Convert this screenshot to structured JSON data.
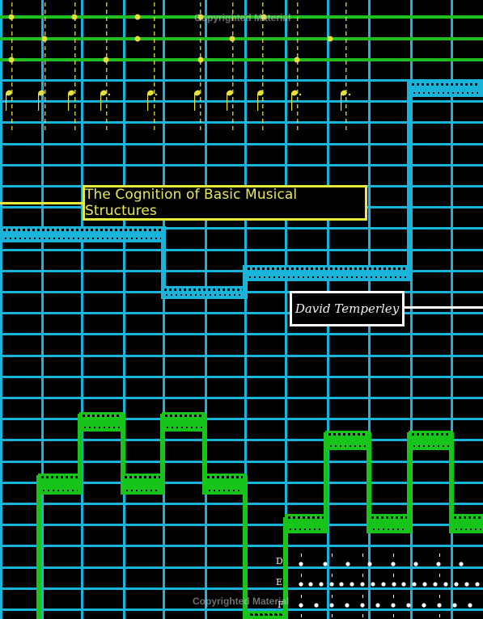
{
  "book": {
    "title": "The Cognition of Basic Musical Structures",
    "author": "David Temperley"
  },
  "pitch_labels": [
    "D",
    "E",
    "F"
  ],
  "watermarks": [
    "Copyrighted Material",
    "Copyrighted Material"
  ],
  "colors": {
    "background": "#000000",
    "grid": "#1ab3d9",
    "staff_green": "#1fbf1f",
    "melody_green": "#17c41a",
    "note_yellow": "#e6e03a",
    "title_border": "#e6ea3a",
    "author_border": "#ffffff",
    "dots": "#ffffff"
  }
}
